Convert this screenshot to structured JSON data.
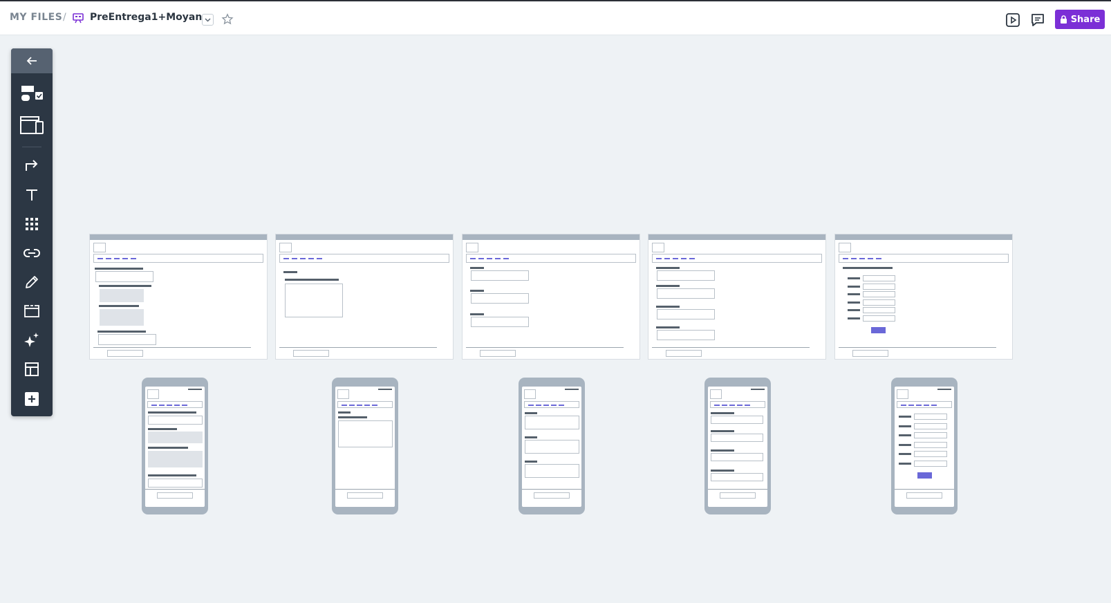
{
  "breadcrumb": {
    "root": "MY FILES",
    "separator": "/",
    "doc_icon": "wireframe-project-icon",
    "title": "PreEntrega1+Moyano"
  },
  "header_actions": {
    "present_icon": "present-play-icon",
    "comments_icon": "comments-icon",
    "share_label": "Share",
    "share_icon": "lock-icon"
  },
  "toolbar": {
    "items": [
      {
        "name": "back",
        "icon": "arrow-left-icon"
      },
      {
        "name": "components",
        "icon": "components-icon"
      },
      {
        "name": "screens",
        "icon": "screens-icon"
      },
      {
        "name": "flow",
        "icon": "flow-arrow-icon"
      },
      {
        "name": "text",
        "icon": "text-icon"
      },
      {
        "name": "grid",
        "icon": "grid-icon"
      },
      {
        "name": "link",
        "icon": "link-icon"
      },
      {
        "name": "draw",
        "icon": "pencil-icon"
      },
      {
        "name": "section",
        "icon": "section-icon"
      },
      {
        "name": "ai",
        "icon": "sparkle-icon"
      },
      {
        "name": "layout",
        "icon": "layout-icon"
      },
      {
        "name": "add",
        "icon": "plus-square-icon"
      }
    ]
  },
  "canvas": {
    "desktop_frames": 5,
    "mobile_frames": 5
  },
  "colors": {
    "accent": "#7b2fd6",
    "toolbar_bg": "#2c3744",
    "canvas_bg": "#eef2f5",
    "wireframe_link": "#6a68d8"
  }
}
